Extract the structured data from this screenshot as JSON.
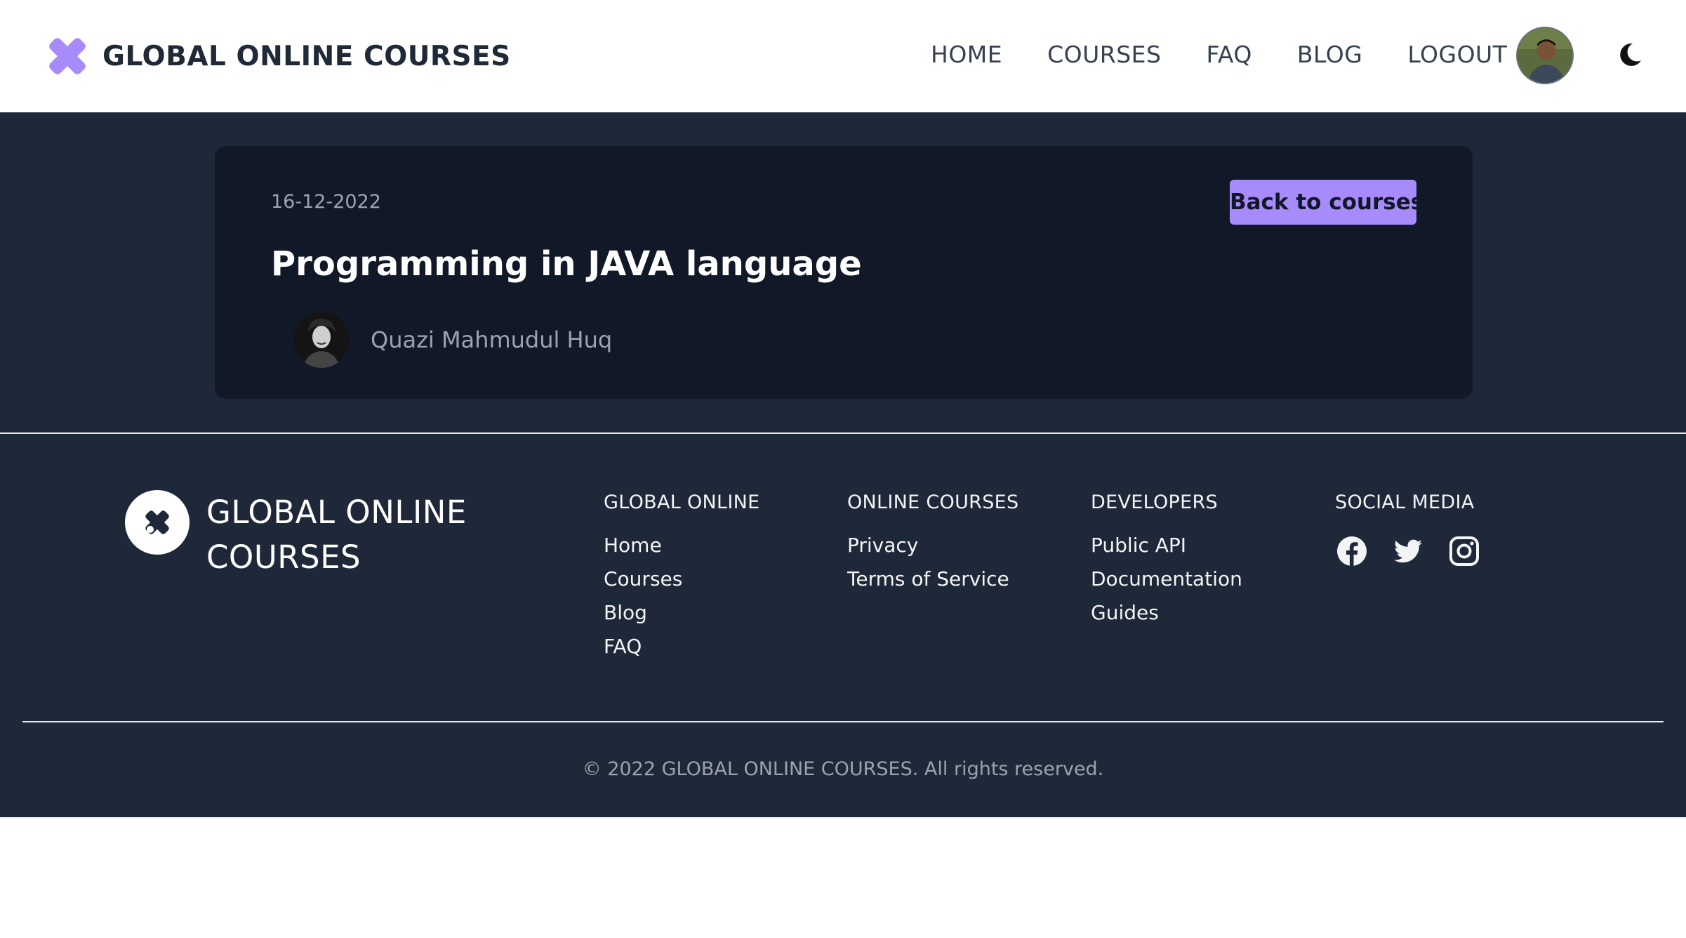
{
  "header": {
    "brand_name": "GLOBAL ONLINE COURSES",
    "nav": [
      "HOME",
      "COURSES",
      "FAQ",
      "BLOG",
      "LOGOUT"
    ]
  },
  "course": {
    "date": "16-12-2022",
    "title": "Programming in JAVA language",
    "author": "Quazi Mahmudul Huq",
    "back_label": "Back to courses"
  },
  "footer": {
    "brand_name": "GLOBAL ONLINE COURSES",
    "columns": [
      {
        "heading": "GLOBAL ONLINE",
        "links": [
          "Home",
          "Courses",
          "Blog",
          "FAQ"
        ]
      },
      {
        "heading": "ONLINE COURSES",
        "links": [
          "Privacy",
          "Terms of Service"
        ]
      },
      {
        "heading": "DEVELOPERS",
        "links": [
          "Public API",
          "Documentation",
          "Guides"
        ]
      }
    ],
    "social": {
      "heading": "SOCIAL MEDIA",
      "icons": [
        "facebook-icon",
        "twitter-icon",
        "instagram-icon"
      ]
    },
    "copyright": "© 2022 GLOBAL ONLINE COURSES. All rights reserved."
  },
  "colors": {
    "accent": "#a78bfa",
    "page_bg": "#1f2838",
    "card_bg": "#111827",
    "header_bg": "#ffffff"
  }
}
